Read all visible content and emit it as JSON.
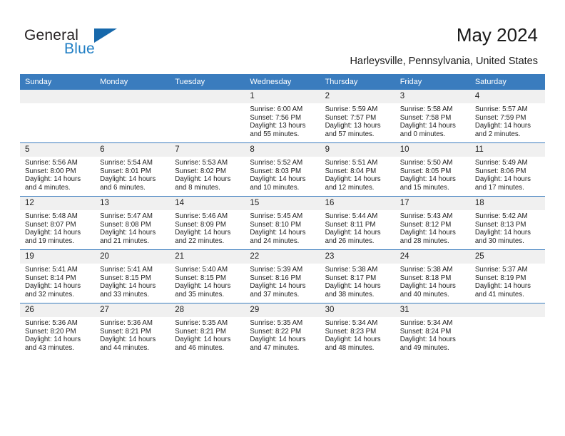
{
  "brand": {
    "name_part1": "General",
    "name_part2": "Blue",
    "triangle_color": "#1668ab",
    "blue_color": "#1f7ec4"
  },
  "header": {
    "title": "May 2024",
    "subtitle": "Harleysville, Pennsylvania, United States",
    "header_bg": "#3a7cbe",
    "daynum_bg": "#f0f0f0"
  },
  "weekday_headers": [
    "Sunday",
    "Monday",
    "Tuesday",
    "Wednesday",
    "Thursday",
    "Friday",
    "Saturday"
  ],
  "labels": {
    "sunrise": "Sunrise:",
    "sunset": "Sunset:",
    "daylight": "Daylight:"
  },
  "weeks": [
    [
      {
        "day": "",
        "empty": true
      },
      {
        "day": "",
        "empty": true
      },
      {
        "day": "",
        "empty": true
      },
      {
        "day": "1",
        "sunrise": "Sunrise: 6:00 AM",
        "sunset": "Sunset: 7:56 PM",
        "daylight": "Daylight: 13 hours and 55 minutes."
      },
      {
        "day": "2",
        "sunrise": "Sunrise: 5:59 AM",
        "sunset": "Sunset: 7:57 PM",
        "daylight": "Daylight: 13 hours and 57 minutes."
      },
      {
        "day": "3",
        "sunrise": "Sunrise: 5:58 AM",
        "sunset": "Sunset: 7:58 PM",
        "daylight": "Daylight: 14 hours and 0 minutes."
      },
      {
        "day": "4",
        "sunrise": "Sunrise: 5:57 AM",
        "sunset": "Sunset: 7:59 PM",
        "daylight": "Daylight: 14 hours and 2 minutes."
      }
    ],
    [
      {
        "day": "5",
        "sunrise": "Sunrise: 5:56 AM",
        "sunset": "Sunset: 8:00 PM",
        "daylight": "Daylight: 14 hours and 4 minutes."
      },
      {
        "day": "6",
        "sunrise": "Sunrise: 5:54 AM",
        "sunset": "Sunset: 8:01 PM",
        "daylight": "Daylight: 14 hours and 6 minutes."
      },
      {
        "day": "7",
        "sunrise": "Sunrise: 5:53 AM",
        "sunset": "Sunset: 8:02 PM",
        "daylight": "Daylight: 14 hours and 8 minutes."
      },
      {
        "day": "8",
        "sunrise": "Sunrise: 5:52 AM",
        "sunset": "Sunset: 8:03 PM",
        "daylight": "Daylight: 14 hours and 10 minutes."
      },
      {
        "day": "9",
        "sunrise": "Sunrise: 5:51 AM",
        "sunset": "Sunset: 8:04 PM",
        "daylight": "Daylight: 14 hours and 12 minutes."
      },
      {
        "day": "10",
        "sunrise": "Sunrise: 5:50 AM",
        "sunset": "Sunset: 8:05 PM",
        "daylight": "Daylight: 14 hours and 15 minutes."
      },
      {
        "day": "11",
        "sunrise": "Sunrise: 5:49 AM",
        "sunset": "Sunset: 8:06 PM",
        "daylight": "Daylight: 14 hours and 17 minutes."
      }
    ],
    [
      {
        "day": "12",
        "sunrise": "Sunrise: 5:48 AM",
        "sunset": "Sunset: 8:07 PM",
        "daylight": "Daylight: 14 hours and 19 minutes."
      },
      {
        "day": "13",
        "sunrise": "Sunrise: 5:47 AM",
        "sunset": "Sunset: 8:08 PM",
        "daylight": "Daylight: 14 hours and 21 minutes."
      },
      {
        "day": "14",
        "sunrise": "Sunrise: 5:46 AM",
        "sunset": "Sunset: 8:09 PM",
        "daylight": "Daylight: 14 hours and 22 minutes."
      },
      {
        "day": "15",
        "sunrise": "Sunrise: 5:45 AM",
        "sunset": "Sunset: 8:10 PM",
        "daylight": "Daylight: 14 hours and 24 minutes."
      },
      {
        "day": "16",
        "sunrise": "Sunrise: 5:44 AM",
        "sunset": "Sunset: 8:11 PM",
        "daylight": "Daylight: 14 hours and 26 minutes."
      },
      {
        "day": "17",
        "sunrise": "Sunrise: 5:43 AM",
        "sunset": "Sunset: 8:12 PM",
        "daylight": "Daylight: 14 hours and 28 minutes."
      },
      {
        "day": "18",
        "sunrise": "Sunrise: 5:42 AM",
        "sunset": "Sunset: 8:13 PM",
        "daylight": "Daylight: 14 hours and 30 minutes."
      }
    ],
    [
      {
        "day": "19",
        "sunrise": "Sunrise: 5:41 AM",
        "sunset": "Sunset: 8:14 PM",
        "daylight": "Daylight: 14 hours and 32 minutes."
      },
      {
        "day": "20",
        "sunrise": "Sunrise: 5:41 AM",
        "sunset": "Sunset: 8:15 PM",
        "daylight": "Daylight: 14 hours and 33 minutes."
      },
      {
        "day": "21",
        "sunrise": "Sunrise: 5:40 AM",
        "sunset": "Sunset: 8:15 PM",
        "daylight": "Daylight: 14 hours and 35 minutes."
      },
      {
        "day": "22",
        "sunrise": "Sunrise: 5:39 AM",
        "sunset": "Sunset: 8:16 PM",
        "daylight": "Daylight: 14 hours and 37 minutes."
      },
      {
        "day": "23",
        "sunrise": "Sunrise: 5:38 AM",
        "sunset": "Sunset: 8:17 PM",
        "daylight": "Daylight: 14 hours and 38 minutes."
      },
      {
        "day": "24",
        "sunrise": "Sunrise: 5:38 AM",
        "sunset": "Sunset: 8:18 PM",
        "daylight": "Daylight: 14 hours and 40 minutes."
      },
      {
        "day": "25",
        "sunrise": "Sunrise: 5:37 AM",
        "sunset": "Sunset: 8:19 PM",
        "daylight": "Daylight: 14 hours and 41 minutes."
      }
    ],
    [
      {
        "day": "26",
        "sunrise": "Sunrise: 5:36 AM",
        "sunset": "Sunset: 8:20 PM",
        "daylight": "Daylight: 14 hours and 43 minutes."
      },
      {
        "day": "27",
        "sunrise": "Sunrise: 5:36 AM",
        "sunset": "Sunset: 8:21 PM",
        "daylight": "Daylight: 14 hours and 44 minutes."
      },
      {
        "day": "28",
        "sunrise": "Sunrise: 5:35 AM",
        "sunset": "Sunset: 8:21 PM",
        "daylight": "Daylight: 14 hours and 46 minutes."
      },
      {
        "day": "29",
        "sunrise": "Sunrise: 5:35 AM",
        "sunset": "Sunset: 8:22 PM",
        "daylight": "Daylight: 14 hours and 47 minutes."
      },
      {
        "day": "30",
        "sunrise": "Sunrise: 5:34 AM",
        "sunset": "Sunset: 8:23 PM",
        "daylight": "Daylight: 14 hours and 48 minutes."
      },
      {
        "day": "31",
        "sunrise": "Sunrise: 5:34 AM",
        "sunset": "Sunset: 8:24 PM",
        "daylight": "Daylight: 14 hours and 49 minutes."
      },
      {
        "day": "",
        "empty": true
      }
    ]
  ]
}
